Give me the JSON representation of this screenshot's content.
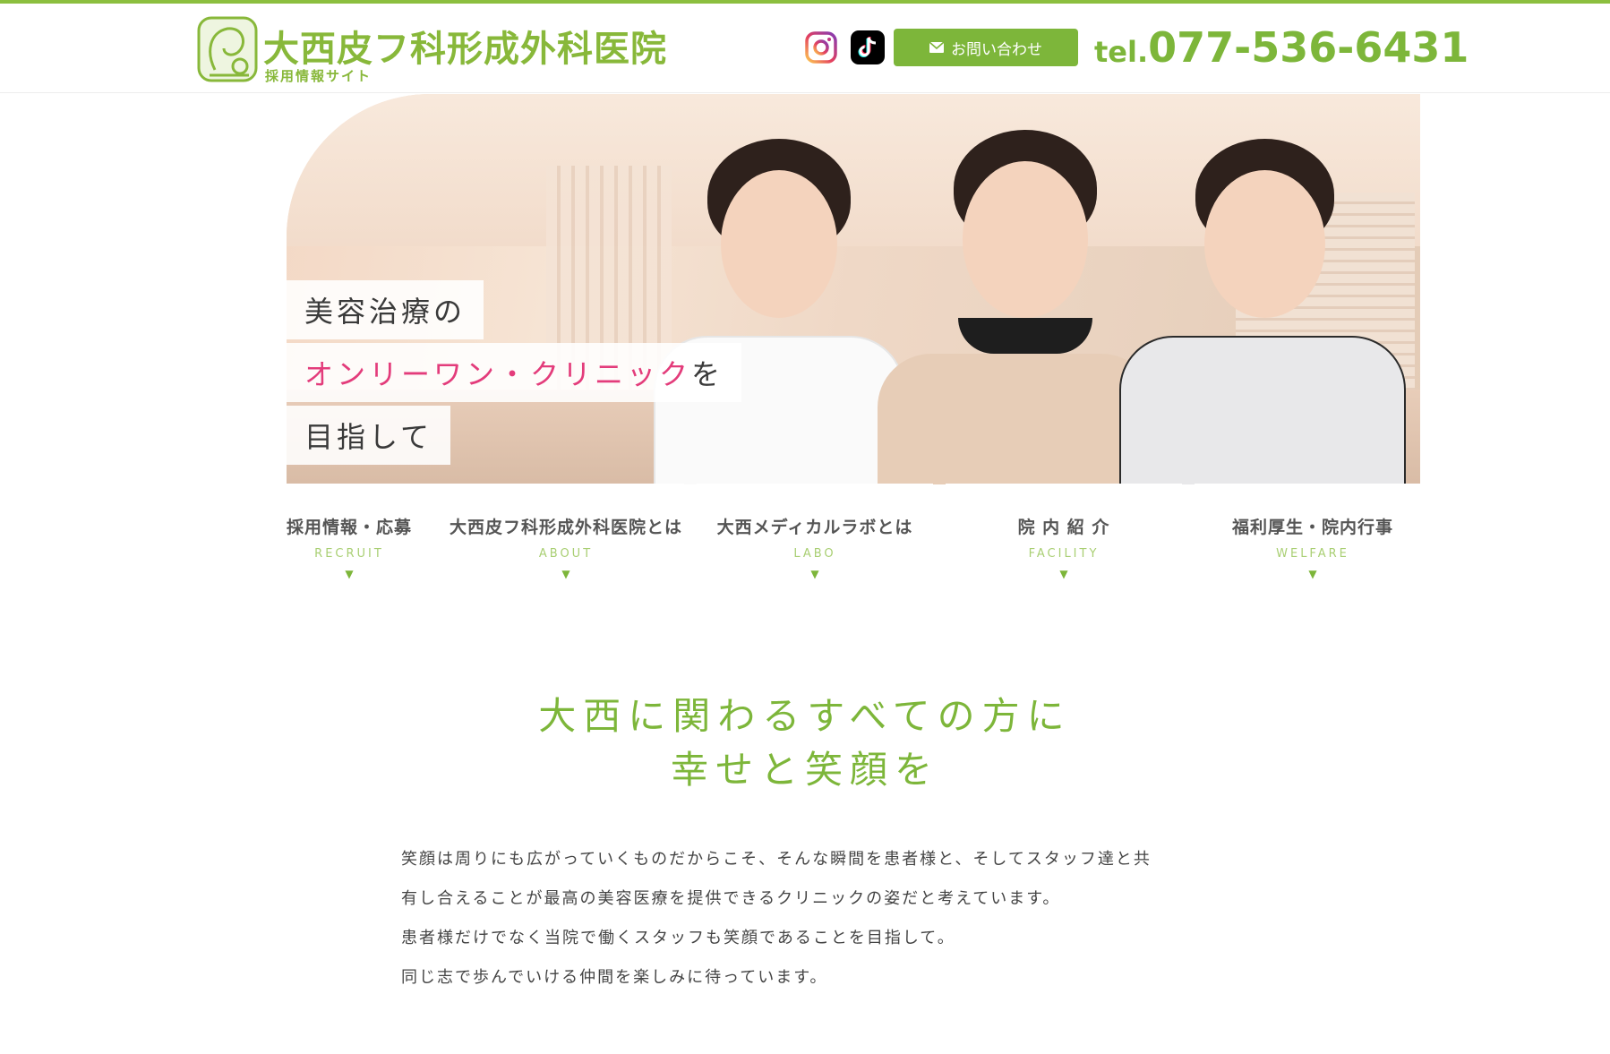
{
  "header": {
    "logo_title": "大西皮フ科形成外科医院",
    "logo_subtitle": "採用情報サイト",
    "contact_label": "お問い合わせ",
    "tel_prefix": "tel.",
    "tel_number": "077-536-6431"
  },
  "hero": {
    "copy_line1": "美容治療の",
    "copy_line2_pink": "オンリーワン・クリニック",
    "copy_line2_tail": "を",
    "copy_line3": "目指して"
  },
  "nav": {
    "items": [
      {
        "label": "採用情報・応募",
        "en": "RECRUIT"
      },
      {
        "label": "大西皮フ科形成外科医院とは",
        "en": "ABOUT"
      },
      {
        "label": "大西メディカルラボとは",
        "en": "LABO"
      },
      {
        "label": "院 内 紹 介",
        "en": "FACILITY"
      },
      {
        "label": "福利厚生・院内行事",
        "en": "WELFARE"
      }
    ],
    "arrow": "▼"
  },
  "main": {
    "lead_line1": "大西に関わるすべての方に",
    "lead_line2": "幸せと笑顔を",
    "paragraphs": [
      "笑顔は周りにも広がっていくものだからこそ、そんな瞬間を患者様と、そしてスタッフ達と共",
      "有し合えることが最高の美容医療を提供できるクリニックの姿だと考えています。",
      "患者様だけでなく当院で働くスタッフも笑顔であることを目指して。",
      "同じ志で歩んでいける仲間を楽しみに待っています。"
    ]
  },
  "icons": {
    "instagram": "instagram-icon",
    "tiktok": "tiktok-icon",
    "mail": "mail-icon"
  },
  "colors": {
    "accent": "#7db63a",
    "accent_light": "#a9cf73",
    "pink": "#e33c7b"
  }
}
